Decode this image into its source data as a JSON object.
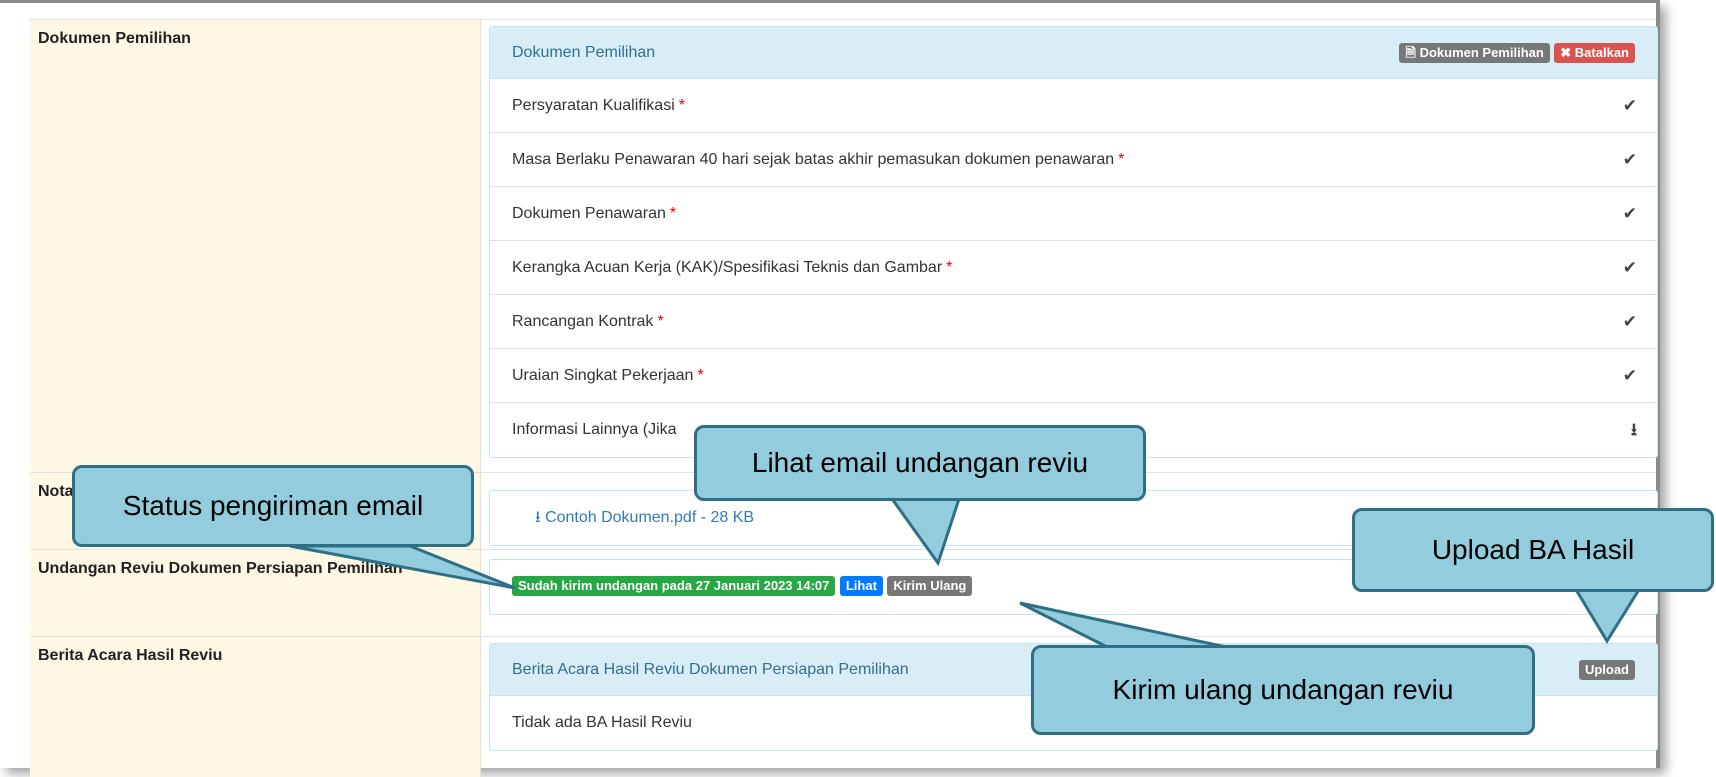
{
  "dokumen": {
    "label": "Dokumen Pemilihan",
    "panel_title": "Dokumen Pemilihan",
    "btn_dokumen": "Dokumen Pemilihan",
    "btn_batalkan": "Batalkan",
    "items": [
      {
        "text": "Persyaratan Kualifikasi",
        "required": "*",
        "icon": "check-icon"
      },
      {
        "text": "Masa Berlaku Penawaran 40 hari sejak batas akhir pemasukan dokumen penawaran",
        "required": "*",
        "icon": "check-icon"
      },
      {
        "text": "Dokumen Penawaran",
        "required": "*",
        "icon": "check-icon"
      },
      {
        "text": "Kerangka Acuan Kerja (KAK)/Spesifikasi Teknis dan Gambar",
        "required": "*",
        "icon": "check-icon"
      },
      {
        "text": "Rancangan Kontrak",
        "required": "*",
        "icon": "check-icon"
      },
      {
        "text": "Uraian Singkat Pekerjaan",
        "required": "*",
        "icon": "check-icon"
      },
      {
        "text": "Informasi Lainnya (Jika",
        "required": "",
        "icon": "upload-icon"
      }
    ]
  },
  "nota": {
    "label": "Nota",
    "file_link": "Contoh Dokumen.pdf - 28 KB"
  },
  "undangan": {
    "label": "Undangan Reviu Dokumen Persiapan Pemilihan",
    "status": "Sudah kirim undangan pada 27 Januari 2023 14:07",
    "lihat": "Lihat",
    "kirim_ulang": "Kirim Ulang"
  },
  "berita": {
    "label": "Berita Acara Hasil Reviu",
    "panel_title": "Berita Acara Hasil Reviu Dokumen Persiapan Pemilihan",
    "upload": "Upload",
    "empty": "Tidak ada BA Hasil Reviu"
  },
  "callouts": {
    "status": "Status pengiriman email",
    "lihat": "Lihat email undangan reviu",
    "upload": "Upload BA Hasil",
    "kirim": "Kirim ulang undangan reviu"
  }
}
